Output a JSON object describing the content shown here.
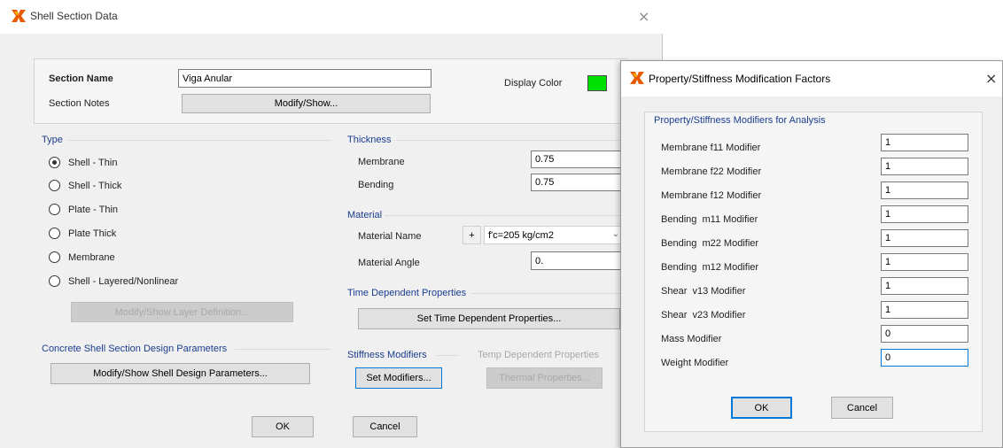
{
  "shell_dialog": {
    "title": "Shell Section Data",
    "section_name_label": "Section Name",
    "section_name_value": "Viga Anular",
    "display_color_label": "Display Color",
    "display_color": "#00e000",
    "section_notes_label": "Section Notes",
    "modify_show_button": "Modify/Show...",
    "type": {
      "title": "Type",
      "options": [
        "Shell - Thin",
        "Shell - Thick",
        "Plate - Thin",
        "Plate Thick",
        "Membrane",
        "Shell - Layered/Nonlinear"
      ],
      "selected": "Shell - Thin",
      "layer_button": "Modify/Show Layer Definition..."
    },
    "thickness": {
      "title": "Thickness",
      "membrane_label": "Membrane",
      "membrane_value": "0.75",
      "bending_label": "Bending",
      "bending_value": "0.75"
    },
    "material": {
      "title": "Material",
      "name_label": "Material Name",
      "plus": "+",
      "name_value": "f'c=205 kg/cm2",
      "angle_label": "Material Angle",
      "angle_value": "0."
    },
    "time_dependent": {
      "title": "Time Dependent Properties",
      "button": "Set Time Dependent Properties..."
    },
    "concrete_design": {
      "title": "Concrete Shell Section Design Parameters",
      "button": "Modify/Show Shell Design Parameters..."
    },
    "stiffness": {
      "title": "Stiffness Modifiers",
      "button": "Set Modifiers..."
    },
    "temp_dependent": {
      "title": "Temp Dependent Properties",
      "button": "Thermal Properties..."
    },
    "ok": "OK",
    "cancel": "Cancel"
  },
  "modifiers_dialog": {
    "title": "Property/Stiffness Modification Factors",
    "group_title": "Property/Stiffness Modifiers for Analysis",
    "rows": [
      {
        "label": "Membrane f11 Modifier",
        "value": "1"
      },
      {
        "label": "Membrane f22 Modifier",
        "value": "1"
      },
      {
        "label": "Membrane f12 Modifier",
        "value": "1"
      },
      {
        "label": "Bending  m11 Modifier",
        "value": "1"
      },
      {
        "label": "Bending  m22 Modifier",
        "value": "1"
      },
      {
        "label": "Bending  m12 Modifier",
        "value": "1"
      },
      {
        "label": "Shear  v13 Modifier",
        "value": "1"
      },
      {
        "label": "Shear  v23 Modifier",
        "value": "1"
      },
      {
        "label": "Mass Modifier",
        "value": "0"
      },
      {
        "label": "Weight Modifier",
        "value": "0"
      }
    ],
    "ok": "OK",
    "cancel": "Cancel"
  }
}
